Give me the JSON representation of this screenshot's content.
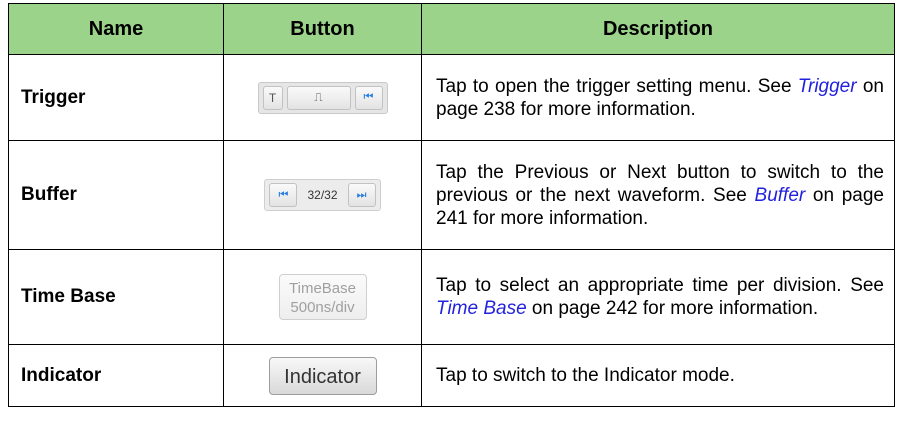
{
  "headers": {
    "name": "Name",
    "button": "Button",
    "description": "Description"
  },
  "rows": [
    {
      "name": "Trigger",
      "widget": {
        "t": "T",
        "wave": "⎍",
        "nav": "⏮"
      },
      "desc_before": "Tap to open the trigger setting menu. See ",
      "link": "Trigger",
      "desc_after": " on page 238 for more information."
    },
    {
      "name": "Buffer",
      "widget": {
        "prev": "⏮",
        "count": "32/32",
        "next": "⏭"
      },
      "desc_before": "Tap the Previous or Next button to switch to the previous or the next waveform. See ",
      "link": "Buffer",
      "desc_after": " on page 241 for more information."
    },
    {
      "name": "Time Base",
      "widget": {
        "line1": "TimeBase",
        "line2": "500ns/div"
      },
      "desc_before": "Tap to select an appropriate time per division. See ",
      "link": "Time Base",
      "desc_after": " on page 242 for more information."
    },
    {
      "name": "Indicator",
      "widget": {
        "label": "Indicator"
      },
      "desc_before": "Tap to switch to the Indicator mode.",
      "link": "",
      "desc_after": ""
    }
  ],
  "colors": {
    "header_bg": "#9bd38a",
    "link": "#2222dd",
    "nav_icon": "#2a7ee0"
  }
}
